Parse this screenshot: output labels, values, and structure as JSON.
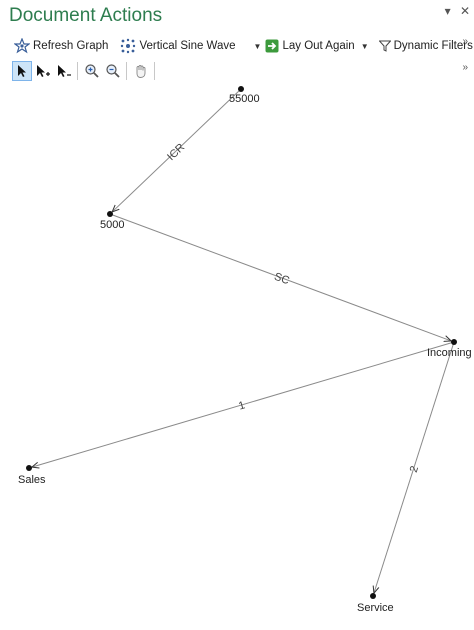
{
  "title": "Document Actions",
  "title_controls": {
    "pin_glyph": "▾",
    "close_glyph": "✕"
  },
  "toolbar": {
    "refresh_label": "Refresh Graph",
    "layout_label": "Vertical Sine Wave",
    "layout_again_label": "Lay Out Again",
    "filters_label": "Dynamic Filters",
    "overflow_glyph": "»"
  },
  "tools": [
    "pointer-tool",
    "add-pointer-tool",
    "remove-pointer-tool",
    "zoom-in-tool",
    "zoom-out-tool",
    "pan-tool"
  ],
  "graph": {
    "nodes": [
      {
        "id": "55000",
        "label": "55000"
      },
      {
        "id": "5000",
        "label": "5000"
      },
      {
        "id": "Incoming",
        "label": "Incoming"
      },
      {
        "id": "Sales",
        "label": "Sales"
      },
      {
        "id": "Service",
        "label": "Service"
      }
    ],
    "edges": [
      {
        "from": "55000",
        "to": "5000",
        "label": "ICR"
      },
      {
        "from": "5000",
        "to": "Incoming",
        "label": "SC"
      },
      {
        "from": "Incoming",
        "to": "Sales",
        "label": "1"
      },
      {
        "from": "Incoming",
        "to": "Service",
        "label": "2"
      }
    ]
  }
}
